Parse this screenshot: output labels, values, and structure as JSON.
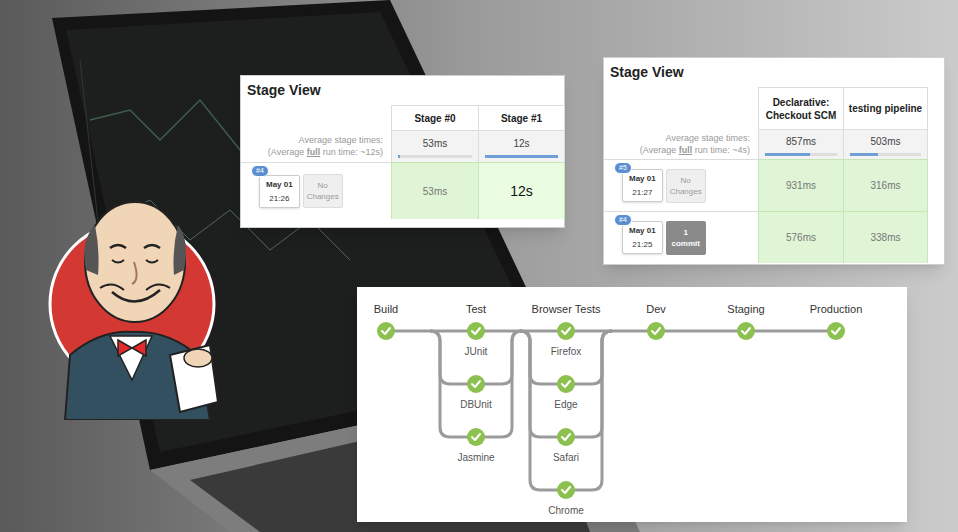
{
  "stage_views": [
    {
      "title": "Stage View",
      "avg_label": "Average stage times:",
      "full_run": {
        "before": "(Average ",
        "emphasis": "full",
        "after": " run time: ~12s)"
      },
      "stages": [
        {
          "name": "Stage #0",
          "average": "53ms",
          "level": 0.03
        },
        {
          "name": "Stage #1",
          "average": "12s",
          "level": 1
        }
      ],
      "runs": [
        {
          "badge": "#4",
          "date": "May 01",
          "time": "21:26",
          "changes": "No Changes",
          "has_commits": false,
          "cells": [
            {
              "text": "53ms",
              "highlighted": false
            },
            {
              "text": "12s",
              "highlighted": true
            }
          ]
        }
      ]
    },
    {
      "title": "Stage View",
      "avg_label": "Average stage times:",
      "full_run": {
        "before": "(Average ",
        "emphasis": "full",
        "after": " run time: ~4s)"
      },
      "stages": [
        {
          "name": "Declarative: Checkout SCM",
          "average": "857ms",
          "level": 0.62
        },
        {
          "name": "testing pipeline",
          "average": "503ms",
          "level": 0.4
        }
      ],
      "runs": [
        {
          "badge": "#5",
          "date": "May 01",
          "time": "21:27",
          "changes": "No Changes",
          "has_commits": false,
          "cells": [
            {
              "text": "931ms",
              "highlighted": false
            },
            {
              "text": "316ms",
              "highlighted": false
            }
          ]
        },
        {
          "badge": "#4",
          "date": "May 01",
          "time": "21:25",
          "changes": "1 commit",
          "has_commits": true,
          "cells": [
            {
              "text": "576ms",
              "highlighted": false
            },
            {
              "text": "338ms",
              "highlighted": false
            }
          ]
        }
      ]
    }
  ],
  "pipeline": {
    "stages": [
      {
        "name": "Build",
        "passed": true,
        "branches": []
      },
      {
        "name": "Test",
        "passed": true,
        "branches": [
          {
            "name": "JUnit",
            "passed": true
          },
          {
            "name": "DBUnit",
            "passed": true
          },
          {
            "name": "Jasmine",
            "passed": true
          }
        ]
      },
      {
        "name": "Browser Tests",
        "passed": true,
        "branches": [
          {
            "name": "Firefox",
            "passed": true
          },
          {
            "name": "Edge",
            "passed": true
          },
          {
            "name": "Safari",
            "passed": true
          },
          {
            "name": "Chrome",
            "passed": true
          }
        ]
      },
      {
        "name": "Dev",
        "passed": true,
        "branches": []
      },
      {
        "name": "Staging",
        "passed": true,
        "branches": []
      },
      {
        "name": "Production",
        "passed": true,
        "branches": []
      }
    ]
  }
}
